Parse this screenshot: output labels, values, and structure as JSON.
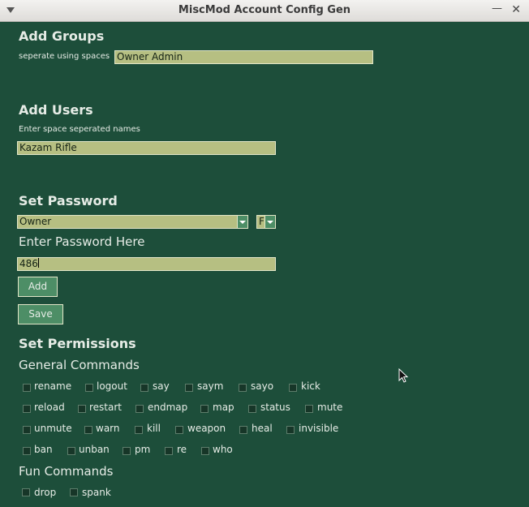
{
  "window": {
    "title": "MiscMod Account Config Gen"
  },
  "add_groups": {
    "heading": "Add Groups",
    "hint": "seperate using spaces",
    "value": "Owner Admin"
  },
  "add_users": {
    "heading": "Add Users",
    "hint": "Enter space seperated names",
    "value": "Kazam Rifle"
  },
  "set_password": {
    "heading": "Set Password",
    "group_select": "Owner",
    "type_select": "F",
    "prompt": "Enter Password Here",
    "value": "486",
    "add_label": "Add",
    "save_label": "Save"
  },
  "permissions": {
    "heading": "Set Permissions",
    "general_heading": "General Commands",
    "general": [
      [
        "rename",
        "logout",
        "say",
        "saym",
        "sayo",
        "kick"
      ],
      [
        "reload",
        "restart",
        "endmap",
        "map",
        "status",
        "mute"
      ],
      [
        "unmute",
        "warn",
        "kill",
        "weapon",
        "heal",
        "invisible"
      ],
      [
        "ban",
        "unban",
        "pm",
        "re",
        "who"
      ]
    ],
    "fun_heading": "Fun Commands",
    "fun": [
      "drop",
      "spank"
    ]
  }
}
